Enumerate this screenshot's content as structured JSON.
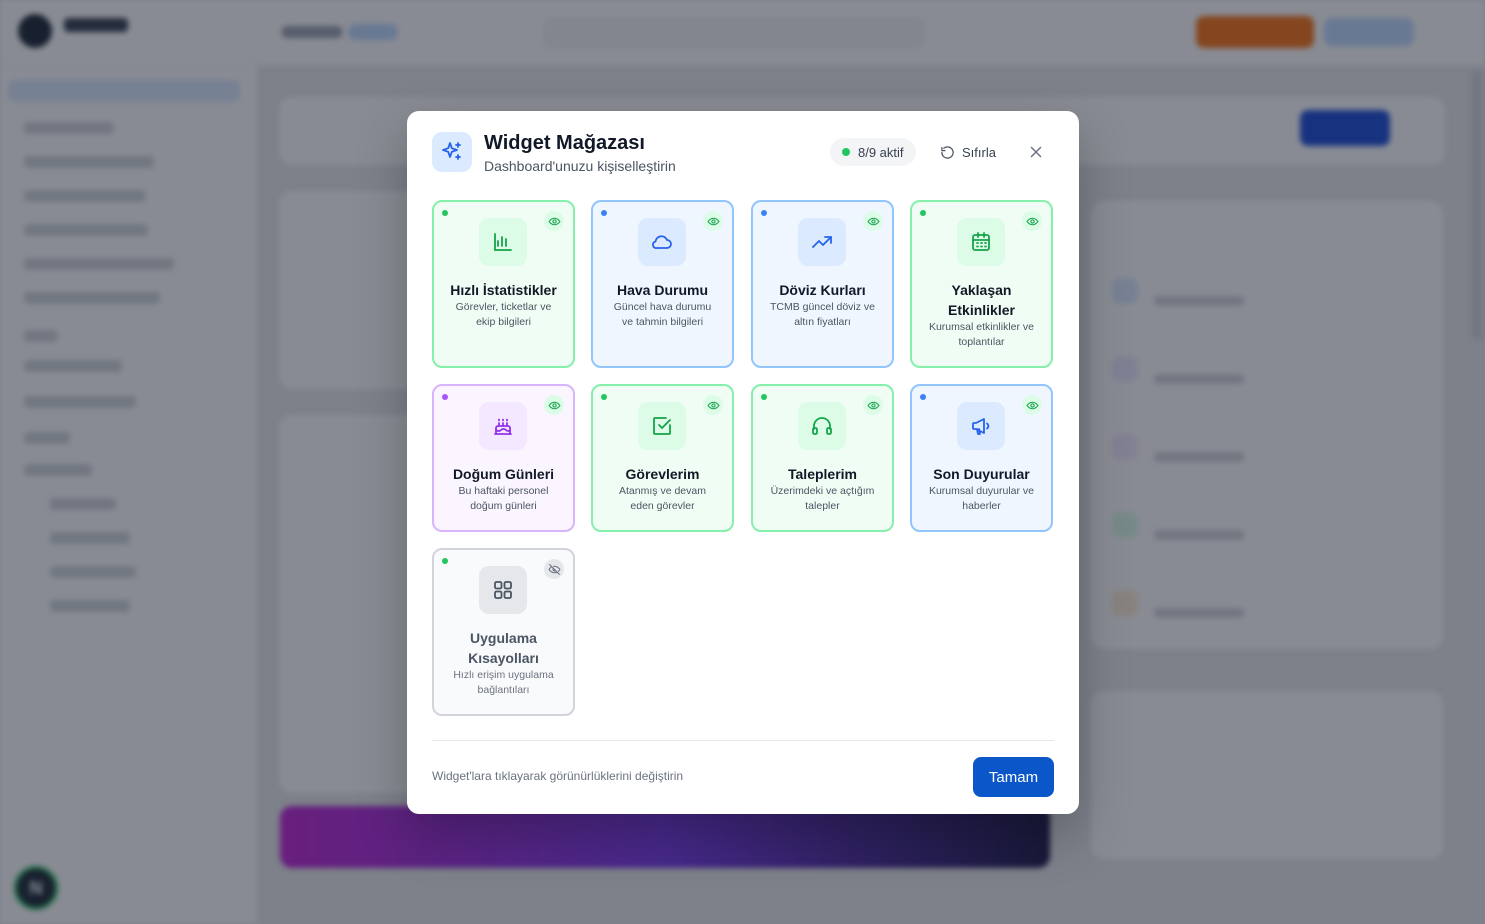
{
  "background": {
    "avatar_initial": "N"
  },
  "modal": {
    "title": "Widget Mağazası",
    "subtitle": "Dashboard'unuzu kişiselleştirin",
    "active_badge": "8/9 aktif",
    "reset_label": "Sıfırla",
    "footer_hint": "Widget'lara tıklayarak görünürlüklerini değiştirin",
    "ok_label": "Tamam",
    "colors": {
      "green": "#22c55e",
      "blue": "#3b82f6",
      "purple": "#a855f7",
      "gray": "#9ca3af",
      "primary": "#0b57c9"
    },
    "widgets": [
      {
        "name": "quick-stats",
        "title": "Hızlı İstatistikler",
        "description": "Görevler, ticketlar ve ekip bilgileri",
        "icon": "bar-chart-icon",
        "theme": "green",
        "visible": true
      },
      {
        "name": "weather",
        "title": "Hava Durumu",
        "description": "Güncel hava durumu ve tahmin bilgileri",
        "icon": "cloud-icon",
        "theme": "blue",
        "visible": true
      },
      {
        "name": "exchange-rates",
        "title": "Döviz Kurları",
        "description": "TCMB güncel döviz ve altın fiyatları",
        "icon": "trending-up-icon",
        "theme": "blue",
        "visible": true
      },
      {
        "name": "upcoming-events",
        "title": "Yaklaşan Etkinlikler",
        "description": "Kurumsal etkinlikler ve toplantılar",
        "icon": "calendar-icon",
        "theme": "green",
        "visible": true
      },
      {
        "name": "birthdays",
        "title": "Doğum Günleri",
        "description": "Bu haftaki personel doğum günleri",
        "icon": "cake-icon",
        "theme": "purple",
        "visible": true
      },
      {
        "name": "my-tasks",
        "title": "Görevlerim",
        "description": "Atanmış ve devam eden görevler",
        "icon": "check-square-icon",
        "theme": "green",
        "visible": true
      },
      {
        "name": "my-requests",
        "title": "Taleplerim",
        "description": "Üzerimdeki ve açtığım talepler",
        "icon": "headphones-icon",
        "theme": "green",
        "visible": true
      },
      {
        "name": "announcements",
        "title": "Son Duyurular",
        "description": "Kurumsal duyurular ve haberler",
        "icon": "megaphone-icon",
        "theme": "blue",
        "visible": true
      },
      {
        "name": "app-shortcuts",
        "title": "Uygulama Kısayolları",
        "description": "Hızlı erişim uygulama bağlantıları",
        "icon": "grid-icon",
        "theme": "gray",
        "visible": false
      }
    ]
  }
}
